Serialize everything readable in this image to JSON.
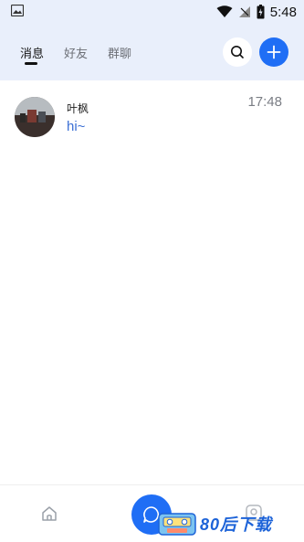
{
  "status_bar": {
    "time": "5:48",
    "icons": [
      "image-icon",
      "wifi-icon",
      "signal-icon",
      "battery-icon"
    ]
  },
  "header": {
    "tabs": [
      {
        "label": "消息",
        "active": true
      },
      {
        "label": "好友",
        "active": false
      },
      {
        "label": "群聊",
        "active": false
      }
    ],
    "search_icon": "search-icon",
    "add_icon": "plus-icon"
  },
  "conversations": [
    {
      "name": "叶枫",
      "last_message": "hi~",
      "time": "17:48"
    }
  ],
  "bottom_nav": {
    "icons": [
      "home-icon",
      "chat-icon",
      "profile-icon"
    ]
  },
  "watermark": {
    "text": "80后下载"
  },
  "colors": {
    "accent": "#1f6ef5",
    "header_bg": "#e9effb",
    "message_text": "#3b6fd4"
  }
}
